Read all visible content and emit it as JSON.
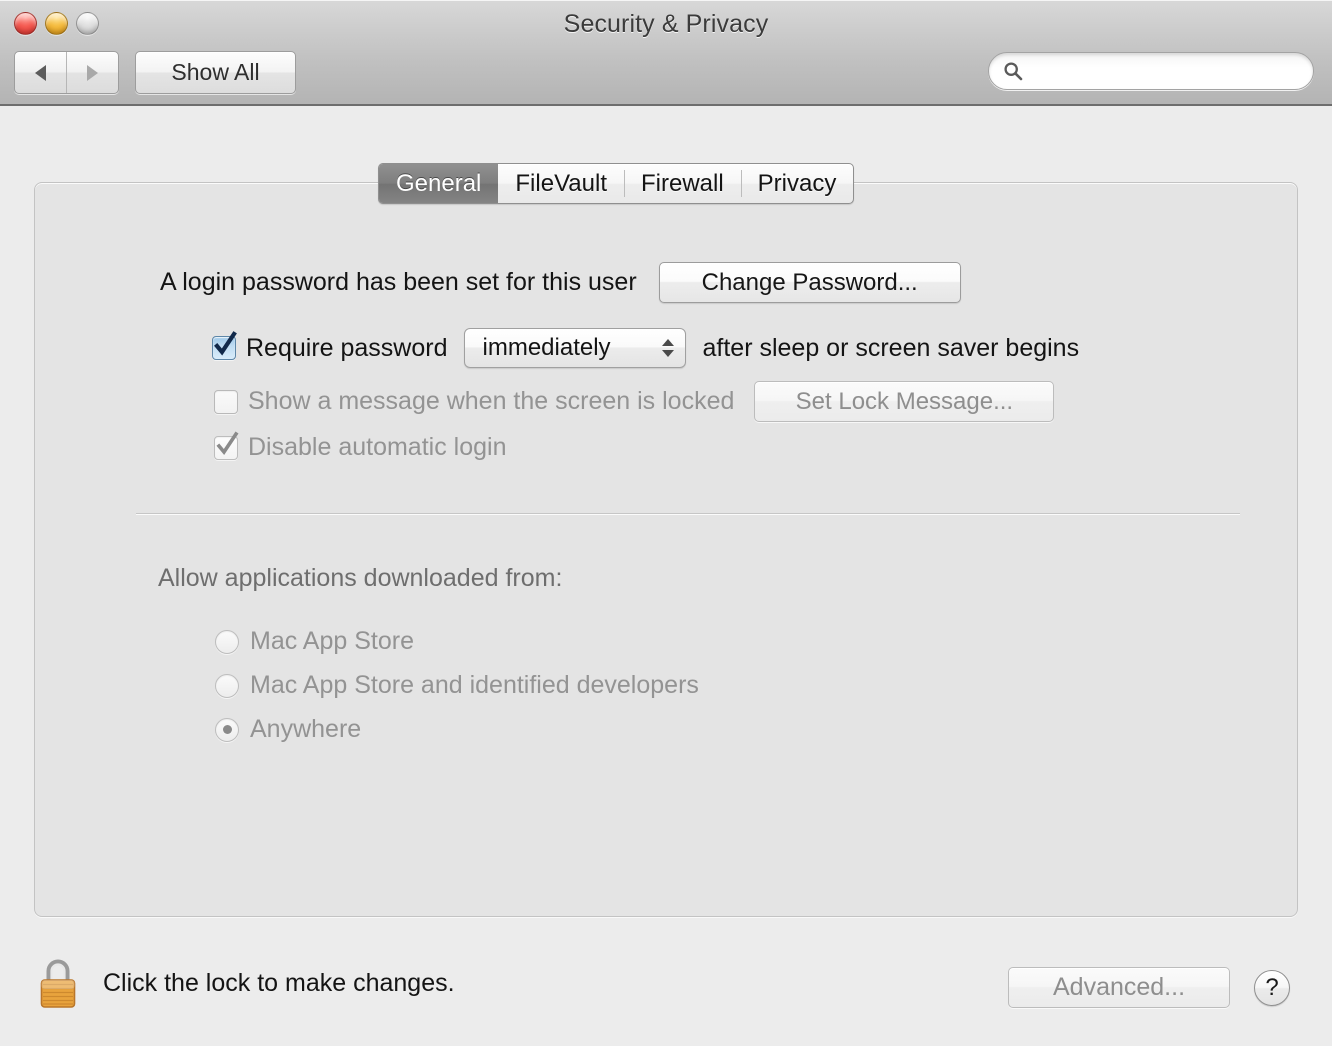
{
  "window": {
    "title": "Security & Privacy",
    "traffic_lights": [
      "close",
      "minimize",
      "zoom"
    ]
  },
  "toolbar": {
    "back_label": "back",
    "forward_label": "forward",
    "show_all_label": "Show All",
    "search": {
      "value": "",
      "placeholder": ""
    }
  },
  "tabs": [
    {
      "label": "General",
      "selected": true
    },
    {
      "label": "FileVault",
      "selected": false
    },
    {
      "label": "Firewall",
      "selected": false
    },
    {
      "label": "Privacy",
      "selected": false
    }
  ],
  "general": {
    "password_status": "A login password has been set for this user",
    "change_password_label": "Change Password...",
    "require_password": {
      "label": "Require password",
      "checked": true,
      "enabled": true,
      "delay_value": "immediately",
      "trailing_text": "after sleep or screen saver begins"
    },
    "lock_message": {
      "label": "Show a message when the screen is locked",
      "checked": false,
      "enabled": false,
      "button_label": "Set Lock Message..."
    },
    "disable_auto_login": {
      "label": "Disable automatic login",
      "checked": true,
      "enabled": false
    },
    "gatekeeper": {
      "heading": "Allow applications downloaded from:",
      "options": [
        {
          "label": "Mac App Store",
          "selected": false
        },
        {
          "label": "Mac App Store and identified developers",
          "selected": false
        },
        {
          "label": "Anywhere",
          "selected": true
        }
      ]
    }
  },
  "footer": {
    "lock_icon": "padlock-closed-icon",
    "lock_text": "Click the lock to make changes.",
    "advanced_label": "Advanced...",
    "advanced_enabled": false,
    "help_label": "?"
  },
  "colors": {
    "window_bg": "#ececec",
    "panel_bg": "#e4e4e4",
    "toolbar_top": "#d8d8d8",
    "toolbar_bottom": "#b4b4b4",
    "tab_selected_bg": "#7e7e7e",
    "checkbox_on": "#bfdcf2",
    "lock_body": "#e8a33d",
    "text": "#141414",
    "text_disabled": "#939393"
  }
}
